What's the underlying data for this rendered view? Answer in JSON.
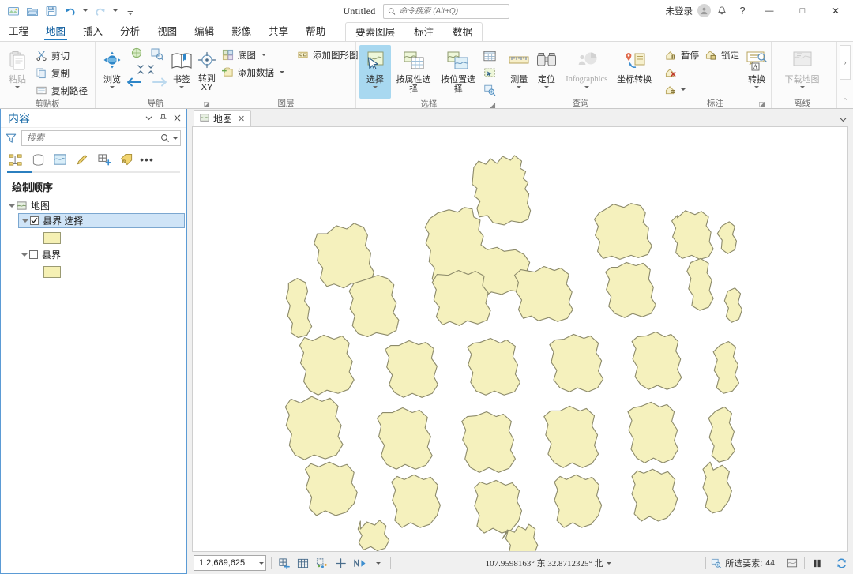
{
  "window": {
    "doc_title": "Untitled",
    "search_placeholder": "命令搜索 (Alt+Q)",
    "signin_label": "未登录",
    "qat": [
      {
        "name": "new-project-icon",
        "tip": "新建"
      },
      {
        "name": "open-project-icon",
        "tip": "打开"
      },
      {
        "name": "save-project-icon",
        "tip": "保存"
      },
      {
        "name": "undo-icon",
        "tip": "撤销"
      },
      {
        "name": "redo-icon",
        "tip": "重做"
      },
      {
        "name": "customize-qat-icon",
        "tip": "自定义快速访问工具栏"
      }
    ],
    "controls": {
      "notifications": "通知",
      "help": "?",
      "minimize": "—",
      "maximize": "□",
      "close": "✕"
    }
  },
  "tabs": {
    "items": [
      {
        "label": "工程",
        "active": false
      },
      {
        "label": "地图",
        "active": true
      },
      {
        "label": "插入",
        "active": false
      },
      {
        "label": "分析",
        "active": false
      },
      {
        "label": "视图",
        "active": false
      },
      {
        "label": "编辑",
        "active": false
      },
      {
        "label": "影像",
        "active": false
      },
      {
        "label": "共享",
        "active": false
      },
      {
        "label": "帮助",
        "active": false
      }
    ],
    "contextual": [
      {
        "label": "要素图层"
      },
      {
        "label": "标注"
      },
      {
        "label": "数据"
      }
    ]
  },
  "ribbon": {
    "groups": [
      {
        "name": "clipboard",
        "label": "剪贴板",
        "big": [
          {
            "label": "粘贴",
            "icon": "paste-icon",
            "disabled": true,
            "caret": true
          }
        ],
        "small": [
          {
            "label": "剪切",
            "icon": "cut-icon"
          },
          {
            "label": "复制",
            "icon": "copy-icon"
          },
          {
            "label": "复制路径",
            "icon": "copy-path-icon"
          }
        ]
      },
      {
        "name": "navigate",
        "label": "导航",
        "big": [
          {
            "label": "浏览",
            "icon": "explore-icon",
            "caret": true
          },
          {
            "label": "书签",
            "icon": "bookmarks-icon",
            "caret": true
          },
          {
            "label": "转到 XY",
            "icon": "go-to-xy-icon",
            "caret": false
          }
        ],
        "has_launcher": true
      },
      {
        "name": "layer",
        "label": "图层",
        "small": [
          {
            "label": "底图",
            "icon": "basemap-icon",
            "caret": true
          },
          {
            "label": "添加数据",
            "icon": "add-data-icon",
            "caret": true
          },
          {
            "label": "添加图形图层",
            "icon": "add-graphics-layer-icon"
          }
        ]
      },
      {
        "name": "selection",
        "label": "选择",
        "big": [
          {
            "label": "选择",
            "icon": "select-icon",
            "caret": true,
            "active": true
          },
          {
            "label": "按属性选择",
            "icon": "select-by-attributes-icon"
          },
          {
            "label": "按位置选择",
            "icon": "select-by-location-icon"
          }
        ],
        "side_icons": [
          "attribute-table-icon",
          "select-all-icon",
          "zoom-to-selection-icon"
        ],
        "has_launcher": true
      },
      {
        "name": "inquiry",
        "label": "查询",
        "big": [
          {
            "label": "测量",
            "icon": "measure-icon",
            "caret": true
          },
          {
            "label": "定位",
            "icon": "locate-icon",
            "caret": true
          },
          {
            "label": "Infographics",
            "icon": "infographics-icon",
            "caret": true,
            "disabled": true
          },
          {
            "label": "坐标转换",
            "icon": "coordinate-conversion-icon"
          }
        ]
      },
      {
        "name": "labeling",
        "label": "标注",
        "small": [
          {
            "label": "暂停",
            "icon": "pause-labeling-icon"
          },
          {
            "label": "锁定",
            "icon": "lock-labeling-icon"
          },
          {
            "label": "",
            "icon": "clear-labeling-icon"
          },
          {
            "label": "",
            "icon": "more-labeling-icon",
            "caret": true
          }
        ],
        "big": [
          {
            "label": "转换",
            "icon": "convert-labels-icon",
            "caret": true
          }
        ],
        "has_launcher": true
      },
      {
        "name": "offline",
        "label": "离线",
        "big": [
          {
            "label": "下载地图",
            "icon": "download-map-icon",
            "caret": true,
            "disabled": true
          }
        ]
      }
    ]
  },
  "contents_pane": {
    "title": "内容",
    "search_placeholder": "搜索",
    "title_buttons": [
      "menu-chevron-icon",
      "pin-icon",
      "close-icon"
    ],
    "tab_icons": [
      "drawing-order-icon",
      "data-source-icon",
      "selection-list-icon",
      "editing-list-icon",
      "snapping-list-icon",
      "labeling-list-icon"
    ],
    "section_title": "绘制顺序",
    "tree": [
      {
        "label": "地图",
        "depth": 0,
        "type": "map",
        "expanded": true
      },
      {
        "label": "县界 选择",
        "depth": 1,
        "type": "layer",
        "checked": true,
        "selected": true,
        "expanded": true
      },
      {
        "label": "",
        "depth": 2,
        "type": "swatch",
        "color": "#f5f0b4"
      },
      {
        "label": "县界",
        "depth": 1,
        "type": "layer",
        "checked": false,
        "selected": false,
        "expanded": true
      },
      {
        "label": "",
        "depth": 2,
        "type": "swatch",
        "color": "#f5f0b4"
      }
    ]
  },
  "map_view": {
    "tab_label": "地图",
    "tab_close": "✕",
    "fill_color": "#f5f1bd",
    "stroke_color": "#8c8a6a"
  },
  "status_bar": {
    "scale": "1:2,689,625",
    "scale_caret": "▾",
    "tools": [
      "add-grid-icon",
      "grid-icon",
      "selection-tools-icon",
      "add-point-icon",
      "north-icon",
      "more-tools-caret"
    ],
    "coordinates": "107.9598163° 东  32.8712325° 北",
    "coordinate_caret": "▾",
    "selected_label": "所选要素:",
    "selected_count": "44",
    "right_icons": [
      "clear-selection-icon",
      "pause-drawing-icon",
      "refresh-icon"
    ]
  },
  "colors": {
    "accent": "#1f7ac1",
    "pane_border": "#5b9bd5",
    "selection_highlight": "#cfe4f7",
    "ribbon_bg": "#fbfbfb",
    "map_fill": "#f5f1bd",
    "map_stroke": "#8c8a6a"
  }
}
